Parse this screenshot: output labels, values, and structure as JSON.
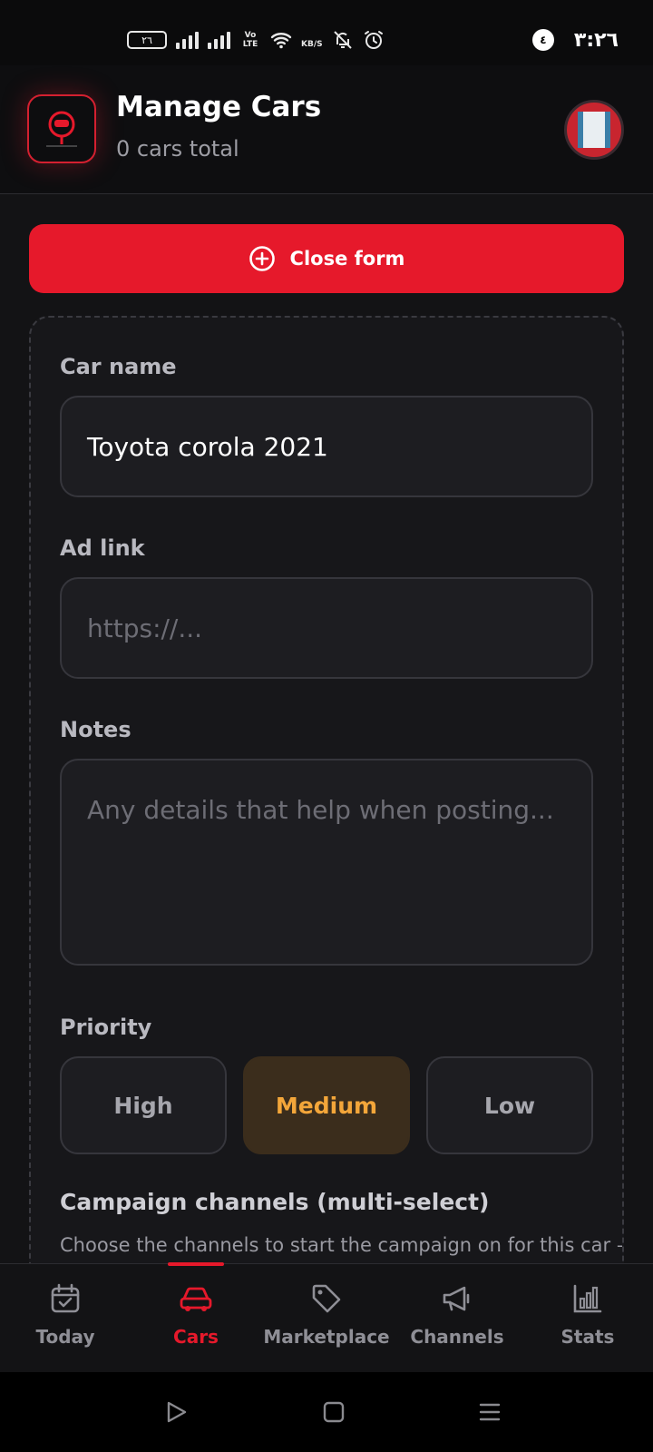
{
  "status_bar": {
    "battery": "٢٦",
    "network": "Vo LTE",
    "speed_unit": "KB/S",
    "notification_count": "٤",
    "time": "٣:٢٦"
  },
  "header": {
    "title": "Manage Cars",
    "subtitle": "0 cars total",
    "logo_icon": "car-logo-icon",
    "avatar_icon": "avatar-image"
  },
  "close_button": {
    "label": "Close form",
    "icon": "plus-circle-icon"
  },
  "form": {
    "car_name": {
      "label": "Car name",
      "value": "Toyota corola 2021"
    },
    "ad_link": {
      "label": "Ad link",
      "placeholder": "https://..."
    },
    "notes": {
      "label": "Notes",
      "placeholder": "Any details that help when posting..."
    },
    "priority": {
      "label": "Priority",
      "options": [
        "High",
        "Medium",
        "Low"
      ],
      "selected": "Medium"
    },
    "channels": {
      "title": "Campaign channels (multi-select)",
      "description": "Choose the channels to start the campaign on for this car —"
    }
  },
  "bottom_nav": {
    "items": [
      {
        "label": "Today",
        "icon": "calendar-check-icon"
      },
      {
        "label": "Cars",
        "icon": "car-icon"
      },
      {
        "label": "Marketplace",
        "icon": "tag-icon"
      },
      {
        "label": "Channels",
        "icon": "megaphone-icon"
      },
      {
        "label": "Stats",
        "icon": "bar-chart-icon"
      }
    ],
    "active": "Cars"
  },
  "colors": {
    "accent": "#e6192b",
    "background": "#131315",
    "priority_selected_text": "#f3a63a",
    "priority_selected_bg": "#3b2d1c"
  }
}
